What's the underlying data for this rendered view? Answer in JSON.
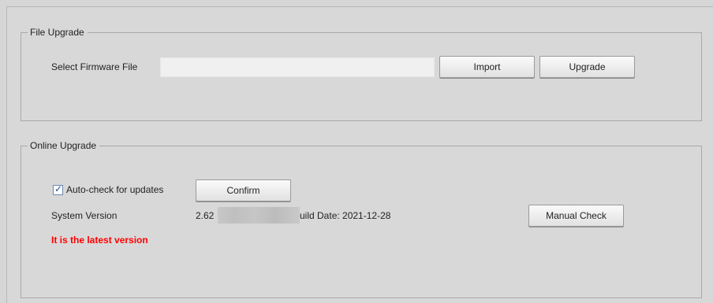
{
  "file_upgrade": {
    "title": "File Upgrade",
    "select_label": "Select Firmware File",
    "file_path_value": "",
    "import_label": "Import",
    "upgrade_label": "Upgrade"
  },
  "online_upgrade": {
    "title": "Online Upgrade",
    "auto_check": {
      "label": "Auto-check for updates",
      "checked": true
    },
    "confirm_label": "Confirm",
    "system_version_label": "System Version",
    "version_prefix": "2.62",
    "version_suffix": "uild Date: 2021-12-28",
    "manual_check_label": "Manual Check",
    "status_text": "It is the latest version",
    "status_color": "#ff0000"
  }
}
